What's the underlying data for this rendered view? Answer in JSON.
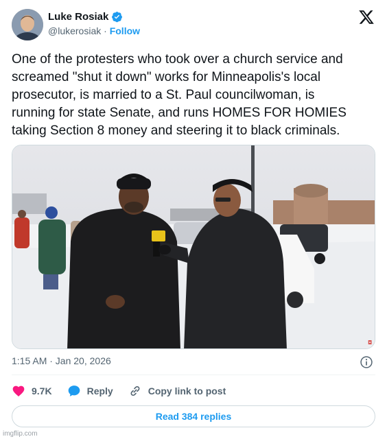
{
  "author": {
    "name": "Luke Rosiak",
    "handle": "@lukerosiak",
    "separator": "·",
    "follow_label": "Follow"
  },
  "tweet": {
    "text": "One of the protesters who took over a church service and\nscreamed \"shut it down\" works for Minneapolis's local\nprosecutor, is married to a St. Paul councilwoman, is\nrunning for state Senate, and runs HOMES FOR HOMIES\ntaking Section 8 money and steering it to black criminals.",
    "timestamp": "1:15 AM · Jan 20, 2026"
  },
  "actions": {
    "likes": "9.7K",
    "reply_label": "Reply",
    "copy_label": "Copy link to post"
  },
  "replies_button": "Read 384 replies",
  "watermark": "imgflip.com",
  "colors": {
    "accent": "#1d9bf0",
    "like": "#f91880",
    "secondary_text": "#536471"
  },
  "icons": [
    "verified-badge-icon",
    "x-logo-icon",
    "info-icon",
    "heart-icon",
    "reply-bubble-icon",
    "link-icon"
  ]
}
